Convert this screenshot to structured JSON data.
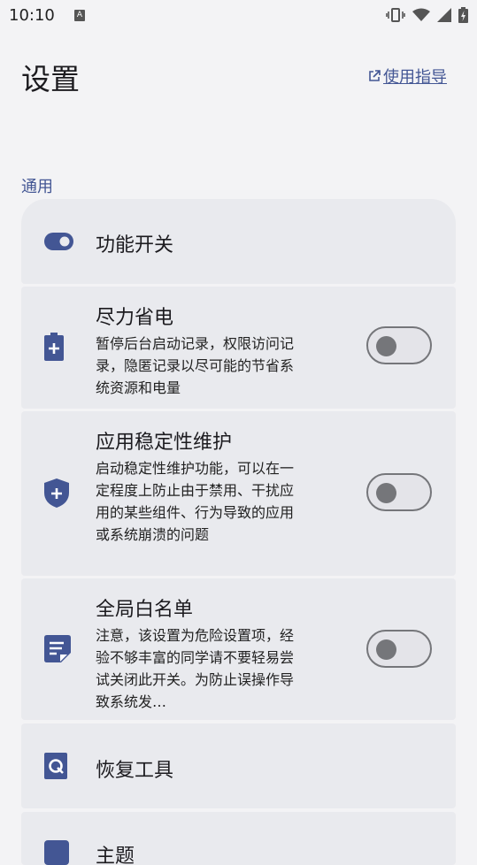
{
  "status": {
    "time": "10:10",
    "notification_letter": "A"
  },
  "header": {
    "title": "设置",
    "guide_link": "使用指导"
  },
  "section": {
    "title": "通用"
  },
  "items": [
    {
      "title": "功能开关",
      "icon": "toggle-icon"
    },
    {
      "title": "尽力省电",
      "desc": "暂停后台启动记录，权限访问记录，隐匿记录以尽可能的节省系统资源和电量",
      "icon": "battery-plus-icon",
      "enabled": false
    },
    {
      "title": "应用稳定性维护",
      "desc": "启动稳定性维护功能，可以在一定程度上防止由于禁用、干扰应用的某些组件、行为导致的应用或系统崩溃的问题",
      "icon": "shield-plus-icon",
      "enabled": false
    },
    {
      "title": "全局白名单",
      "desc": "注意，该设置为危险设置项，经验不够丰富的同学请不要轻易尝试关闭此开关。为防止误操作导致系统发…",
      "icon": "document-icon",
      "enabled": false
    },
    {
      "title": "恢复工具",
      "icon": "restore-icon"
    },
    {
      "title": "主题",
      "icon": "theme-icon"
    }
  ],
  "colors": {
    "accent": "#435694",
    "card_bg": "#e9eaee",
    "page_bg": "#f3f3f5",
    "switch_off": "#75767a"
  }
}
